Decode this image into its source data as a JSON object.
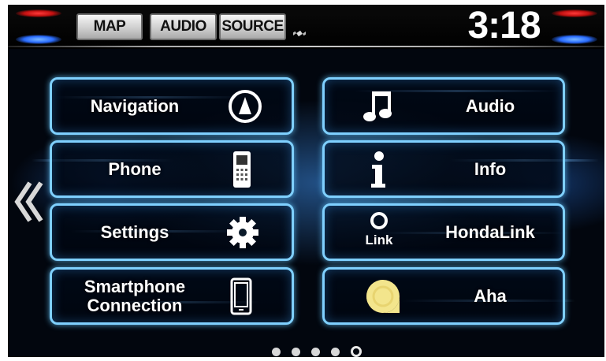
{
  "topbar": {
    "buttons": [
      {
        "id": "map",
        "label": "MAP"
      },
      {
        "id": "audio",
        "label": "AUDIO"
      },
      {
        "id": "source",
        "label": "SOURCE"
      }
    ],
    "gps_icon": "satellite-icon",
    "clock": "3:18"
  },
  "menu": {
    "tiles": [
      {
        "label": "Navigation",
        "icon": "navigation-compass-icon"
      },
      {
        "label": "Audio",
        "icon": "music-note-icon"
      },
      {
        "label": "Phone",
        "icon": "cell-phone-icon"
      },
      {
        "label": "Info",
        "icon": "info-icon"
      },
      {
        "label": "Settings",
        "icon": "gear-icon"
      },
      {
        "label": "HondaLink",
        "icon": "link-icon",
        "icon_text": "Link"
      },
      {
        "label": "Smartphone Connection",
        "icon": "smartphone-icon"
      },
      {
        "label": "Aha",
        "icon": "aha-icon"
      }
    ]
  },
  "pager": {
    "pages": 5,
    "active": 5
  },
  "colors": {
    "tile_border": "#7fd0ff",
    "background": "#000000",
    "aha_yellow": "#f3e58c"
  }
}
